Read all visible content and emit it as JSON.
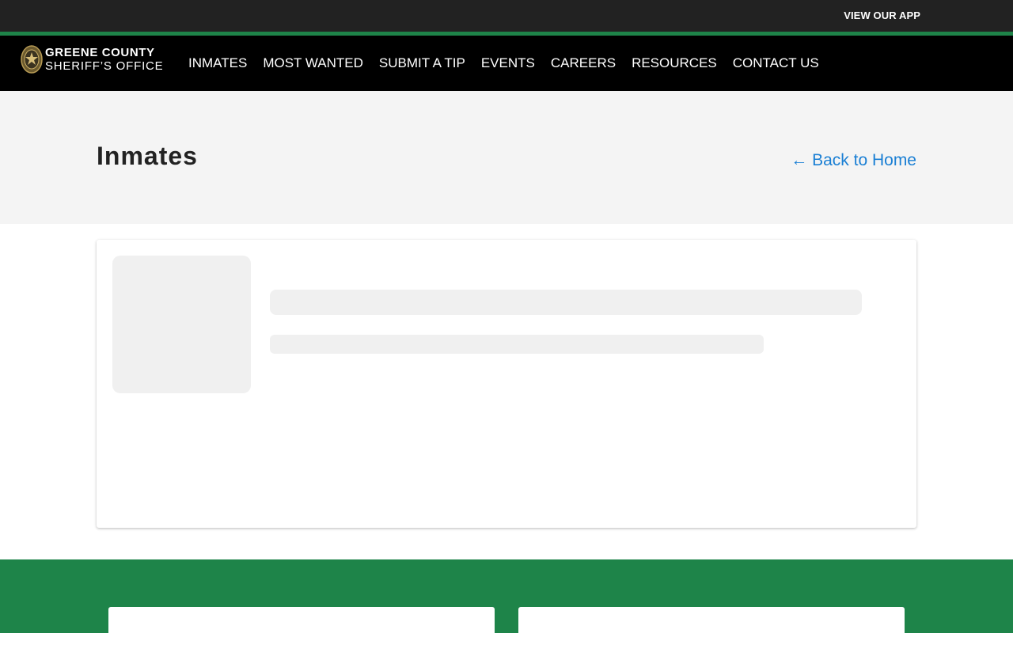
{
  "topbar": {
    "app_link": "VIEW OUR APP"
  },
  "brand": {
    "line1": "GREENE COUNTY",
    "line2": "SHERIFF’S OFFICE",
    "badge_icon": "sheriff-badge-icon"
  },
  "nav": {
    "items": [
      "INMATES",
      "MOST WANTED",
      "SUBMIT A TIP",
      "EVENTS",
      "CAREERS",
      "RESOURCES",
      "CONTACT US"
    ]
  },
  "hero": {
    "title": "Inmates",
    "back_link": "← Back to Home"
  },
  "colors": {
    "topbar": "#222222",
    "accent": "#1e8449",
    "navbar": "#000000",
    "hero_bg": "#f4f4f4",
    "link": "#1a7fd4",
    "skeleton": "#f0f0f0"
  }
}
